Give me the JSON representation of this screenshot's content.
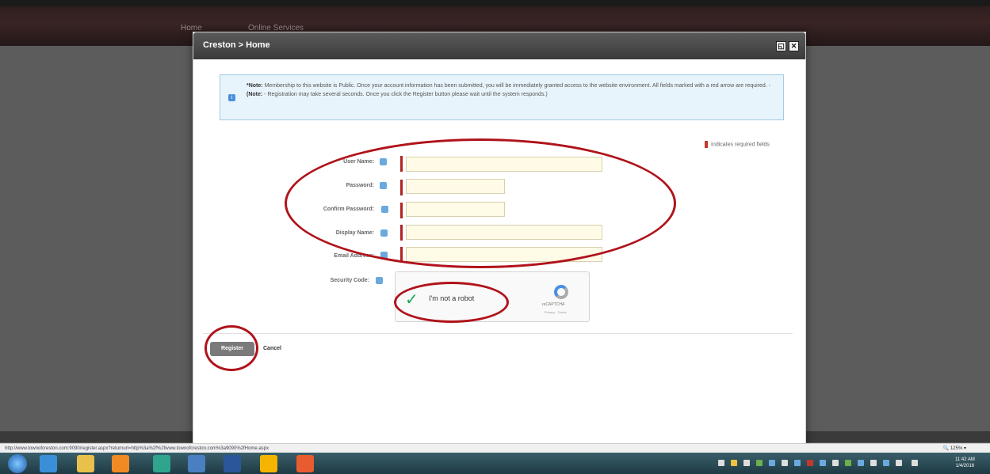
{
  "site_nav": {
    "items": [
      "Home",
      "Online Services"
    ]
  },
  "modal": {
    "title": "Creston > Home",
    "maximize_icon": "maximize-icon",
    "close_icon": "close-icon"
  },
  "note": {
    "label": "*Note:",
    "text1": " Membership to this website is Public. Once your account information has been submitted, you will be immediately granted access to the website environment. All fields marked with a red arrow are required. - ",
    "label2": "(Note:",
    "text2": " - Registration may take several seconds. Once you click the Register button please wait until the system responds.)"
  },
  "required_legend": "Indicates required fields",
  "form": {
    "user_name_label": "User Name:",
    "password_label": "Password:",
    "confirm_password_label": "Confirm Password:",
    "display_name_label": "Display Name:",
    "email_label": "Email Address:",
    "security_code_label": "Security Code:",
    "user_name_value": "",
    "password_value": "",
    "confirm_password_value": "",
    "display_name_value": "",
    "email_value": ""
  },
  "captcha": {
    "text": "I'm not a robot",
    "brand": "reCAPTCHA",
    "links": "Privacy - Terms"
  },
  "buttons": {
    "register": "Register",
    "cancel": "Cancel"
  },
  "status_bar": {
    "url": "http://www.townofcreston.com:9090/register.aspx?returnurl=http%3a%2f%2fwww.townofcreston.com%3a9090%2fHome.aspx",
    "zoom": "125%"
  },
  "clock": {
    "time": "11:42 AM",
    "date": "1/4/2016"
  },
  "colors": {
    "annotation": "#b0131b",
    "required": "#b22222",
    "header": "#3b3b3b"
  }
}
